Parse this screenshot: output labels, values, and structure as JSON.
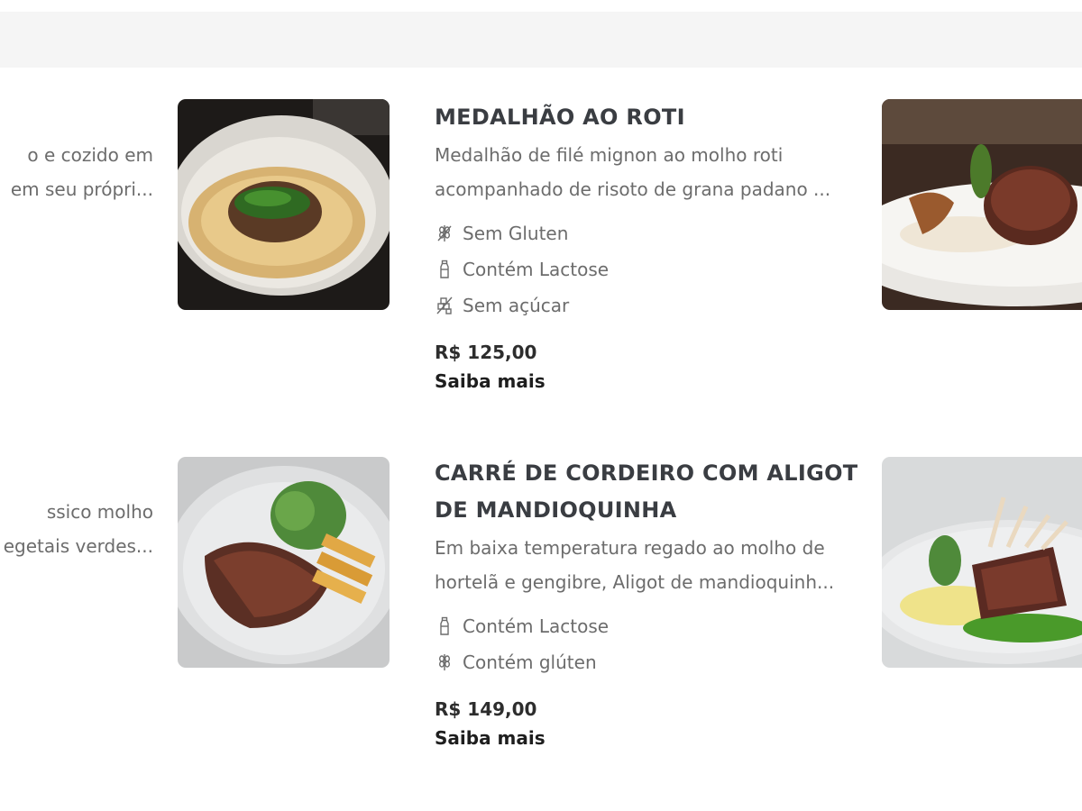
{
  "fragments": {
    "left_top": [
      "o e cozido em",
      "em seu própri..."
    ],
    "left_bottom": [
      "ssico molho",
      "egetais verdes..."
    ]
  },
  "items": [
    {
      "title_lines": [
        "MEDALHÃO AO ROTI"
      ],
      "description_lines": [
        "Medalhão de filé mignon ao molho roti",
        "acompanhado de risoto de grana padano ..."
      ],
      "tags": [
        {
          "icon": "no-gluten-icon",
          "label": "Sem Gluten"
        },
        {
          "icon": "milk-bottle-icon",
          "label": "Contém Lactose"
        },
        {
          "icon": "no-sugar-icon",
          "label": "Sem açúcar"
        }
      ],
      "price": "R$ 125,00",
      "more_label": "Saiba mais"
    },
    {
      "title_lines": [
        "CARRÉ DE CORDEIRO COM ALIGOT",
        "DE MANDIOQUINHA"
      ],
      "description_lines": [
        "Em baixa temperatura regado ao molho de",
        "hortelã e gengibre, Aligot de mandioquinh..."
      ],
      "tags": [
        {
          "icon": "milk-bottle-icon",
          "label": "Contém Lactose"
        },
        {
          "icon": "wheat-icon",
          "label": "Contém glúten"
        }
      ],
      "price": "R$ 149,00",
      "more_label": "Saiba mais"
    }
  ],
  "colors": {
    "topbar": "#f5f5f5",
    "title": "#3a3d42",
    "text": "#6c6c6c",
    "price": "#2d2d2d"
  }
}
